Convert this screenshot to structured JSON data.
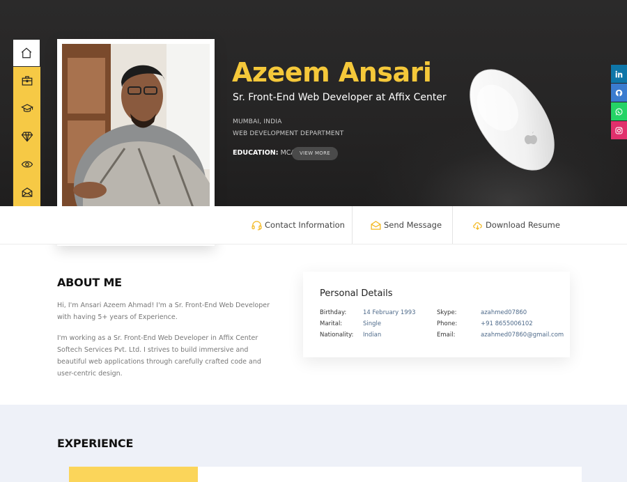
{
  "profile": {
    "name": "Azeem Ansari",
    "title": "Sr. Front-End Web Developer at Affix Center",
    "location": "MUMBAI, INDIA",
    "department": "WEB DEVELOPMENT DEPARTMENT",
    "education_label": "EDUCATION:",
    "education_value": "MCA",
    "view_more": "VIEW MORE"
  },
  "sidenav": {
    "items": [
      {
        "icon": "home-icon",
        "active": true
      },
      {
        "icon": "briefcase-icon"
      },
      {
        "icon": "graduation-cap-icon"
      },
      {
        "icon": "diamond-icon"
      },
      {
        "icon": "eye-icon"
      },
      {
        "icon": "envelope-icon"
      }
    ]
  },
  "social": [
    {
      "icon": "linkedin-icon",
      "color": "#0e76a8"
    },
    {
      "icon": "github-icon",
      "color": "#3b7ccf"
    },
    {
      "icon": "whatsapp-icon",
      "color": "#25d366"
    },
    {
      "icon": "instagram-icon",
      "color": "#e1306c"
    }
  ],
  "actions": {
    "contact": "Contact Information",
    "message": "Send Message",
    "resume": "Download Resume"
  },
  "about": {
    "heading": "ABOUT ME",
    "p1": "Hi, I'm Ansari Azeem Ahmad! I'm a Sr. Front-End Web Developer with having 5+ years of Experience.",
    "p2": "I'm working as a Sr. Front-End Web Developer in Affix Center Softech Services Pvt. Ltd. I strives to build immersive and beautiful web applications through carefully crafted code and user-centric design."
  },
  "personal_details": {
    "heading": "Personal Details",
    "birthday_label": "Birthday:",
    "birthday": "14 February 1993",
    "marital_label": "Marital:",
    "marital": "Single",
    "nationality_label": "Nationality:",
    "nationality": "Indian",
    "skype_label": "Skype:",
    "skype": "azahmed07860",
    "phone_label": "Phone:",
    "phone": "+91 8655006102",
    "email_label": "Email:",
    "email": "azahmed07860@gmail.com"
  },
  "experience": {
    "heading": "EXPERIENCE"
  },
  "colors": {
    "accent": "#f6c945",
    "dark": "#2b2a2a"
  }
}
